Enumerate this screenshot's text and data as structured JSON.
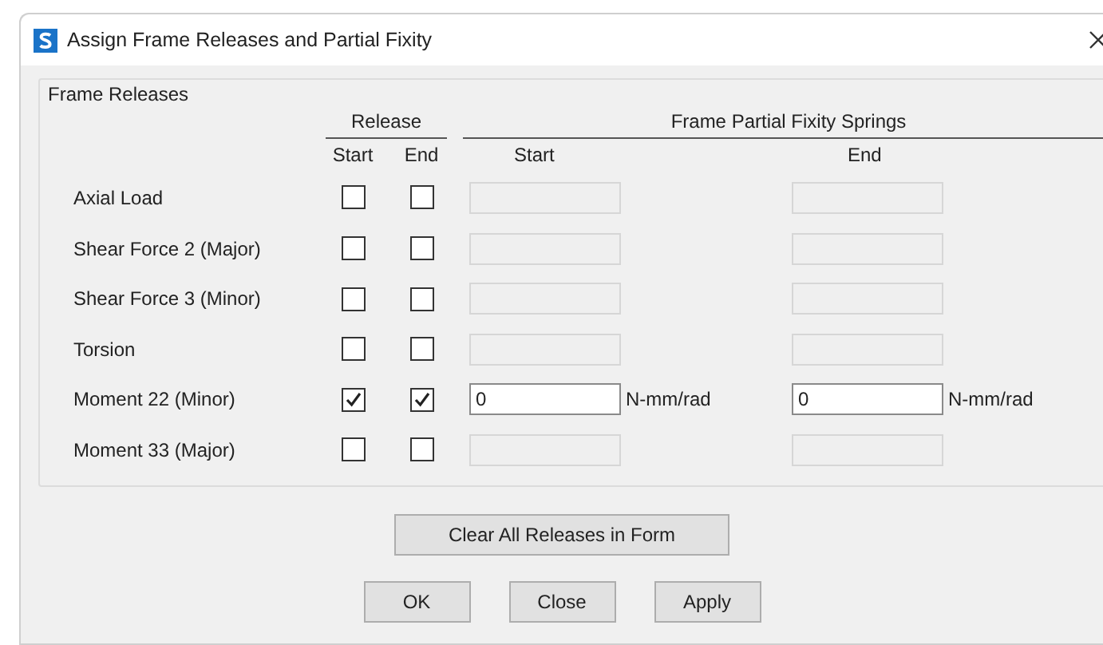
{
  "window": {
    "title": "Assign Frame Releases and Partial Fixity"
  },
  "group": {
    "title": "Frame Releases",
    "release_header": "Release",
    "springs_header": "Frame Partial Fixity Springs",
    "release_start_header": "Start",
    "release_end_header": "End",
    "spring_start_header": "Start",
    "spring_end_header": "End",
    "rows": [
      {
        "label": "Axial Load",
        "release_start": false,
        "release_end": false,
        "spring_start": {
          "enabled": false
        },
        "spring_end": {
          "enabled": false
        }
      },
      {
        "label": "Shear Force 2 (Major)",
        "release_start": false,
        "release_end": false,
        "spring_start": {
          "enabled": false
        },
        "spring_end": {
          "enabled": false
        }
      },
      {
        "label": "Shear Force 3 (Minor)",
        "release_start": false,
        "release_end": false,
        "spring_start": {
          "enabled": false
        },
        "spring_end": {
          "enabled": false
        }
      },
      {
        "label": "Torsion",
        "release_start": false,
        "release_end": false,
        "spring_start": {
          "enabled": false
        },
        "spring_end": {
          "enabled": false
        }
      },
      {
        "label": "Moment 22 (Minor)",
        "release_start": true,
        "release_end": true,
        "spring_start": {
          "enabled": true,
          "value": "0",
          "unit": "N-mm/rad"
        },
        "spring_end": {
          "enabled": true,
          "value": "0",
          "unit": "N-mm/rad"
        }
      },
      {
        "label": "Moment 33 (Major)",
        "release_start": false,
        "release_end": false,
        "spring_start": {
          "enabled": false
        },
        "spring_end": {
          "enabled": false
        }
      }
    ]
  },
  "clear_button": "Clear All Releases in Form",
  "buttons": [
    "OK",
    "Close",
    "Apply"
  ]
}
